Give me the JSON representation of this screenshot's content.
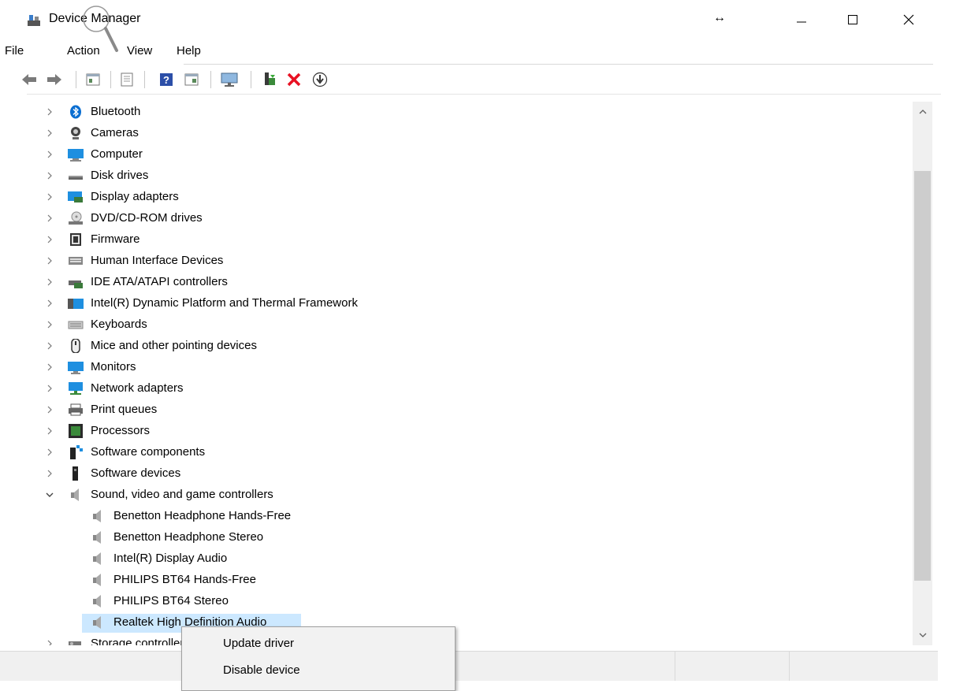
{
  "window": {
    "title": "Device Manager",
    "resize_cursor": "↔",
    "controls": {
      "minimize": "—",
      "maximize": "☐",
      "close": "✕"
    }
  },
  "menu": [
    "File",
    "Action",
    "View",
    "Help"
  ],
  "toolbar": {
    "buttons": [
      "back-icon",
      "forward-icon",
      "properties-icon",
      "show-hidden-icon",
      "help-icon",
      "view-icon",
      "monitor-icon",
      "update-driver-icon",
      "uninstall-icon",
      "download-icon"
    ]
  },
  "tree": {
    "categories": [
      {
        "label": "Bluetooth",
        "icon": "bluetooth-icon",
        "expanded": false
      },
      {
        "label": "Cameras",
        "icon": "camera-icon",
        "expanded": false
      },
      {
        "label": "Computer",
        "icon": "computer-icon",
        "expanded": false
      },
      {
        "label": "Disk drives",
        "icon": "disk-icon",
        "expanded": false
      },
      {
        "label": "Display adapters",
        "icon": "display-adapter-icon",
        "expanded": false
      },
      {
        "label": "DVD/CD-ROM drives",
        "icon": "dvd-icon",
        "expanded": false
      },
      {
        "label": "Firmware",
        "icon": "firmware-icon",
        "expanded": false
      },
      {
        "label": "Human Interface Devices",
        "icon": "hid-icon",
        "expanded": false
      },
      {
        "label": "IDE ATA/ATAPI controllers",
        "icon": "ide-icon",
        "expanded": false
      },
      {
        "label": "Intel(R) Dynamic Platform and Thermal Framework",
        "icon": "intel-folder-icon",
        "expanded": false
      },
      {
        "label": "Keyboards",
        "icon": "keyboard-icon",
        "expanded": false
      },
      {
        "label": "Mice and other pointing devices",
        "icon": "mouse-icon",
        "expanded": false
      },
      {
        "label": "Monitors",
        "icon": "monitor-icon",
        "expanded": false
      },
      {
        "label": "Network adapters",
        "icon": "network-icon",
        "expanded": false
      },
      {
        "label": "Print queues",
        "icon": "printer-icon",
        "expanded": false
      },
      {
        "label": "Processors",
        "icon": "processor-icon",
        "expanded": false
      },
      {
        "label": "Software components",
        "icon": "software-component-icon",
        "expanded": false
      },
      {
        "label": "Software devices",
        "icon": "software-device-icon",
        "expanded": false
      },
      {
        "label": "Sound, video and game controllers",
        "icon": "speaker-icon",
        "expanded": true
      }
    ],
    "sound_children": [
      "Benetton Headphone Hands-Free",
      "Benetton Headphone Stereo",
      "Intel(R) Display Audio",
      "PHILIPS BT64 Hands-Free",
      "PHILIPS BT64 Stereo",
      "Realtek High Definition Audio"
    ],
    "next_category": "Storage controllers",
    "selected_item": "Realtek High Definition Audio"
  },
  "context_menu": {
    "items": [
      "Update driver",
      "Disable device"
    ]
  },
  "colors": {
    "selection": "#cce8ff",
    "uninstall_red": "#e81123",
    "bluetooth_blue": "#0a6ed1"
  }
}
